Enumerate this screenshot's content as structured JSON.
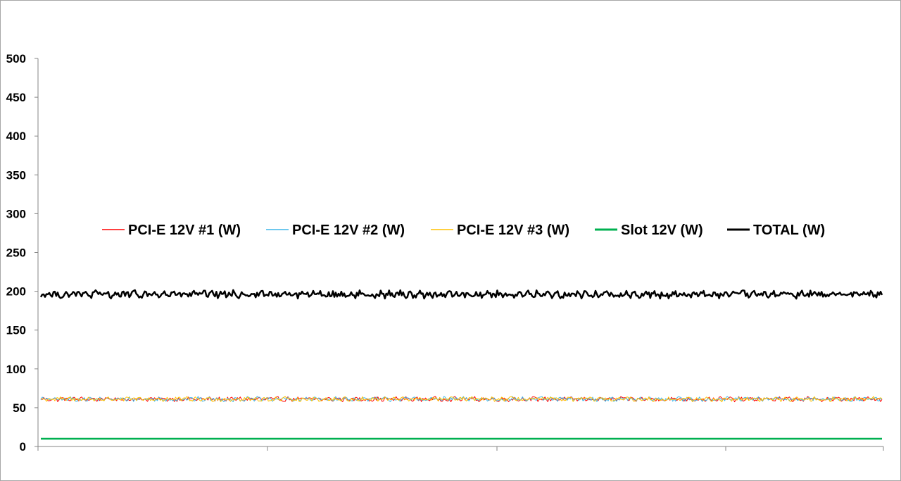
{
  "chart_data": {
    "type": "line",
    "title": "",
    "xlabel": "",
    "ylabel": "",
    "ylim": [
      0,
      500
    ],
    "y_ticks": [
      "0",
      "50",
      "100",
      "150",
      "200",
      "250",
      "300",
      "350",
      "400",
      "450",
      "500"
    ],
    "x_tick_labels": [],
    "grid": false,
    "legend_position": "center",
    "series": [
      {
        "name": "PCI-E 12V #1 (W)",
        "color": "#ff0000",
        "mean": 61,
        "noise": 2.5
      },
      {
        "name": "PCI-E 12V #2 (W)",
        "color": "#3fb6e8",
        "mean": 61,
        "noise": 2.5
      },
      {
        "name": "PCI-E 12V #3 (W)",
        "color": "#ffc000",
        "mean": 61,
        "noise": 2.5
      },
      {
        "name": "Slot 12V (W)",
        "color": "#00b050",
        "mean": 10,
        "noise": 0
      },
      {
        "name": "TOTAL (W)",
        "color": "#000000",
        "mean": 196,
        "noise": 4
      }
    ]
  }
}
